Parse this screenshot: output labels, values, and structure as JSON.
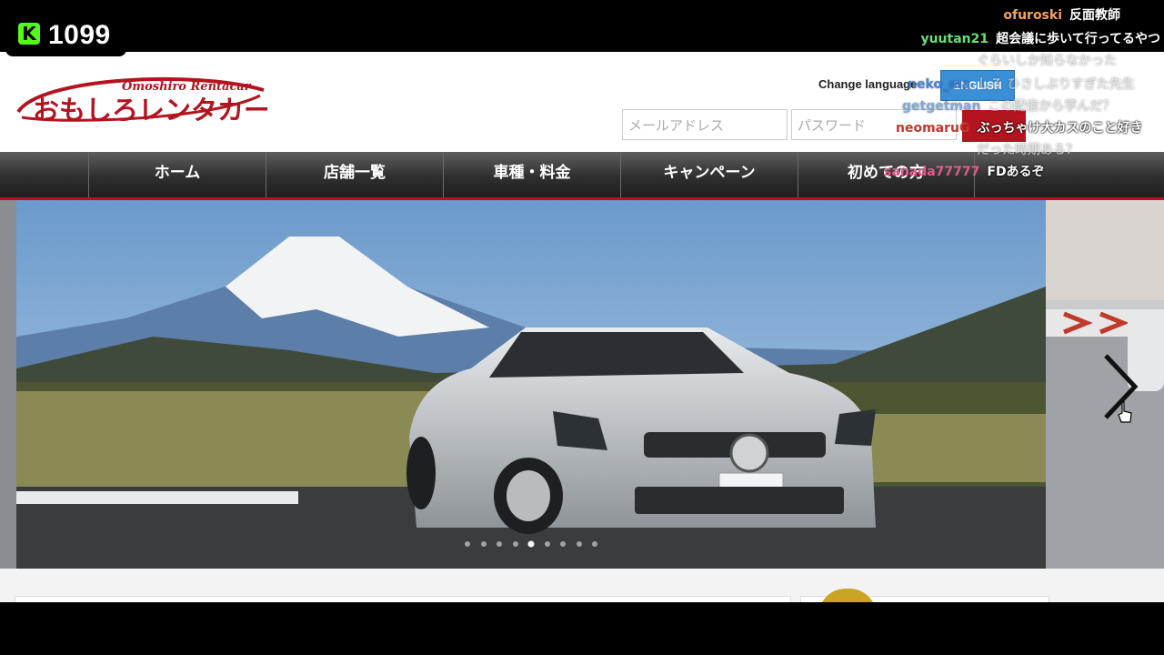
{
  "stream": {
    "viewer_count": "1099",
    "platform_icon": "kick-logo-icon",
    "accent": "#53fc18"
  },
  "site": {
    "logo": {
      "sub": "Omoshiro Rentacar",
      "main": "おもしろレンタカー"
    },
    "change_language_label": "Change language",
    "language_button": "ENGLISH",
    "email_placeholder": "メールアドレス",
    "password_placeholder": "パスワード",
    "nav": [
      "ホーム",
      "店舗一覧",
      "車種・料金",
      "キャンペーン",
      "初めての方"
    ],
    "slider": {
      "dots": 9,
      "active_dot": 5
    },
    "brand_color": "#b3141f"
  },
  "chat": [
    {
      "user": "ofuroski",
      "user_color": "#f4a261",
      "msg": "反面教師"
    },
    {
      "user": "yuutan21",
      "user_color": "#66e07a",
      "msg": "超会議に歩いて行ってるやつ"
    },
    {
      "user": "",
      "user_color": "#ffffff",
      "msg": "ぐらいしか知らなかった"
    },
    {
      "user": "neko_ma",
      "user_color": "#3a7bd5",
      "msg": "しろ ひさしぶりすぎた先生"
    },
    {
      "user": "getgetman",
      "user_color": "#7aa7d8",
      "msg": "この配信から学んだ？"
    },
    {
      "user": "neomaruG",
      "user_color": "#c0392b",
      "msg": "ぶっちゃけ大カスのこと好き"
    },
    {
      "user": "",
      "user_color": "#ffffff",
      "msg": "だった時期ある？"
    },
    {
      "user": "sanada77777",
      "user_color": "#e05a8a",
      "msg": "FDあるぞ"
    }
  ]
}
